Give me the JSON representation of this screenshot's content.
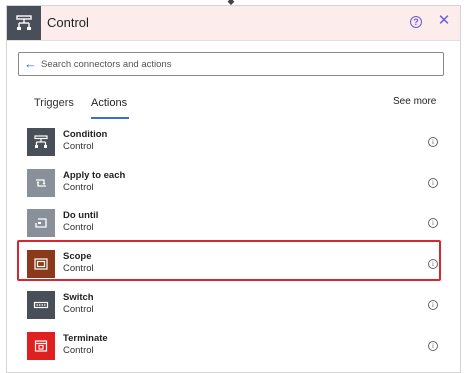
{
  "header": {
    "title": "Control",
    "icon": "control-icon",
    "accent_color": "#fdecec"
  },
  "search": {
    "placeholder": "Search connectors and actions",
    "value": ""
  },
  "tabs": [
    {
      "label": "Triggers",
      "selected": false
    },
    {
      "label": "Actions",
      "selected": true
    }
  ],
  "see_more_label": "See more",
  "items": [
    {
      "name": "Condition",
      "sub": "Control",
      "icon": "condition-icon",
      "color": "#484f58"
    },
    {
      "name": "Apply to each",
      "sub": "Control",
      "icon": "apply-to-each-icon",
      "color": "#8a9099"
    },
    {
      "name": "Do until",
      "sub": "Control",
      "icon": "do-until-icon",
      "color": "#8a9099"
    },
    {
      "name": "Scope",
      "sub": "Control",
      "icon": "scope-icon",
      "color": "#8a3a1a",
      "highlighted": true
    },
    {
      "name": "Switch",
      "sub": "Control",
      "icon": "switch-icon",
      "color": "#484f58"
    },
    {
      "name": "Terminate",
      "sub": "Control",
      "icon": "terminate-icon",
      "color": "#e02020"
    }
  ]
}
